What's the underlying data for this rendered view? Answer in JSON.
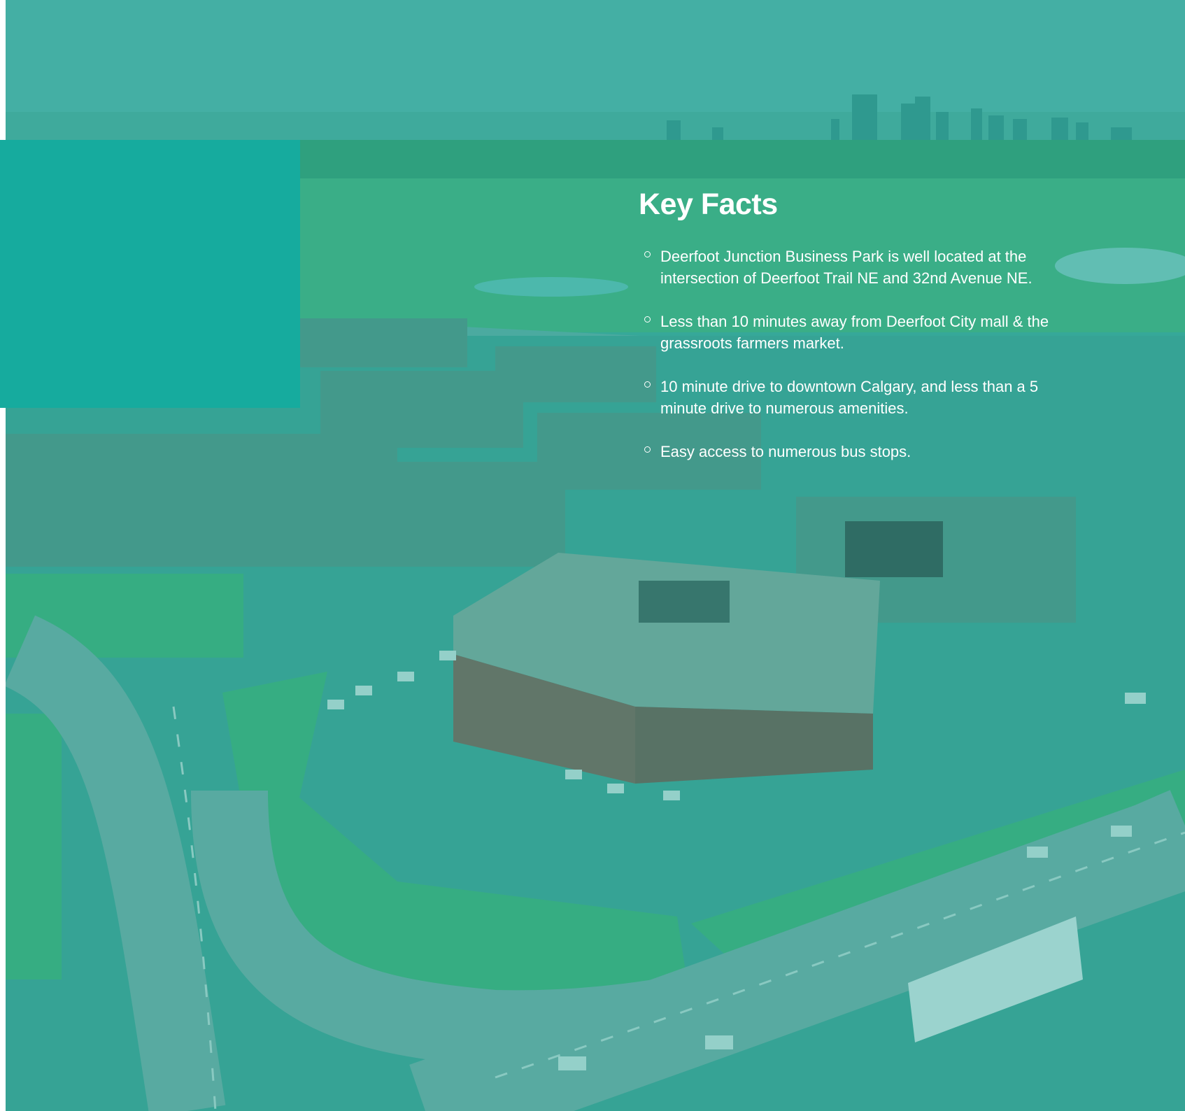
{
  "colors": {
    "accent_block": "#16ab9e",
    "overlay_teal": "#30aca0",
    "text": "#ffffff"
  },
  "key_facts": {
    "title": "Key Facts",
    "items": [
      {
        "text": "Deerfoot Junction Business Park is well located at the intersection of Deerfoot Trail NE and 32nd Avenue NE.",
        "icon": "circle-bullet-icon"
      },
      {
        "text": "Less than 10 minutes away from Deerfoot City mall & the grassroots farmers market.",
        "icon": "circle-bullet-icon"
      },
      {
        "text": "10 minute drive to downtown Calgary, and less than a 5 minute drive to numerous amenities.",
        "icon": "circle-bullet-icon"
      },
      {
        "text": "Easy access to numerous bus stops.",
        "icon": "circle-bullet-icon"
      }
    ]
  }
}
